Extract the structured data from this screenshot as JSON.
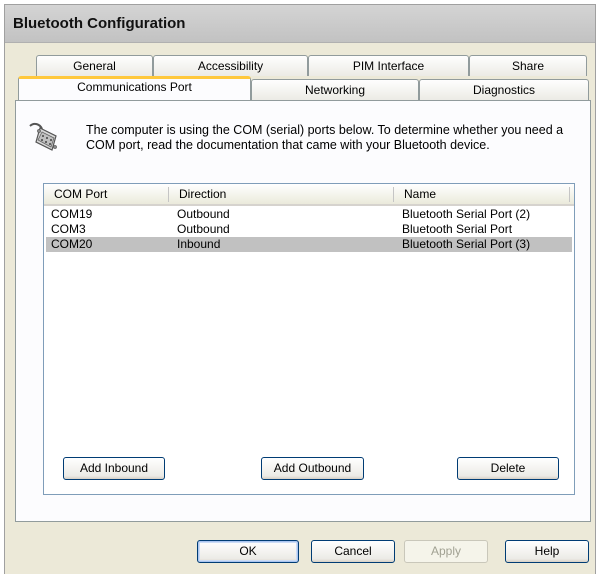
{
  "window": {
    "title": "Bluetooth Configuration"
  },
  "tabs_back": [
    "General",
    "Accessibility",
    "PIM Interface",
    "Share"
  ],
  "tabs_front": [
    "Communications Port",
    "Networking",
    "Diagnostics"
  ],
  "active_tab": "Communications Port",
  "info": {
    "icon": "serial-cable-icon",
    "text": "The computer is using the COM (serial) ports below.  To determine whether you need a COM port, read the documentation that came with your Bluetooth device."
  },
  "table": {
    "columns": [
      "COM Port",
      "Direction",
      "Name"
    ],
    "rows": [
      {
        "port": "COM19",
        "direction": "Outbound",
        "name": "Bluetooth Serial Port (2)"
      },
      {
        "port": "COM3",
        "direction": "Outbound",
        "name": "Bluetooth Serial Port"
      },
      {
        "port": "COM20",
        "direction": "Inbound",
        "name": "Bluetooth Serial Port (3)"
      }
    ],
    "selected_row": 2
  },
  "panel_buttons": {
    "add_inbound": "Add Inbound",
    "add_outbound": "Add Outbound",
    "delete": "Delete"
  },
  "dialog_buttons": {
    "ok": "OK",
    "cancel": "Cancel",
    "apply": "Apply",
    "help": "Help"
  },
  "colors": {
    "tab_highlight": "#ffc83c",
    "selection": "#c1c1c1",
    "button_border": "#003c74"
  }
}
